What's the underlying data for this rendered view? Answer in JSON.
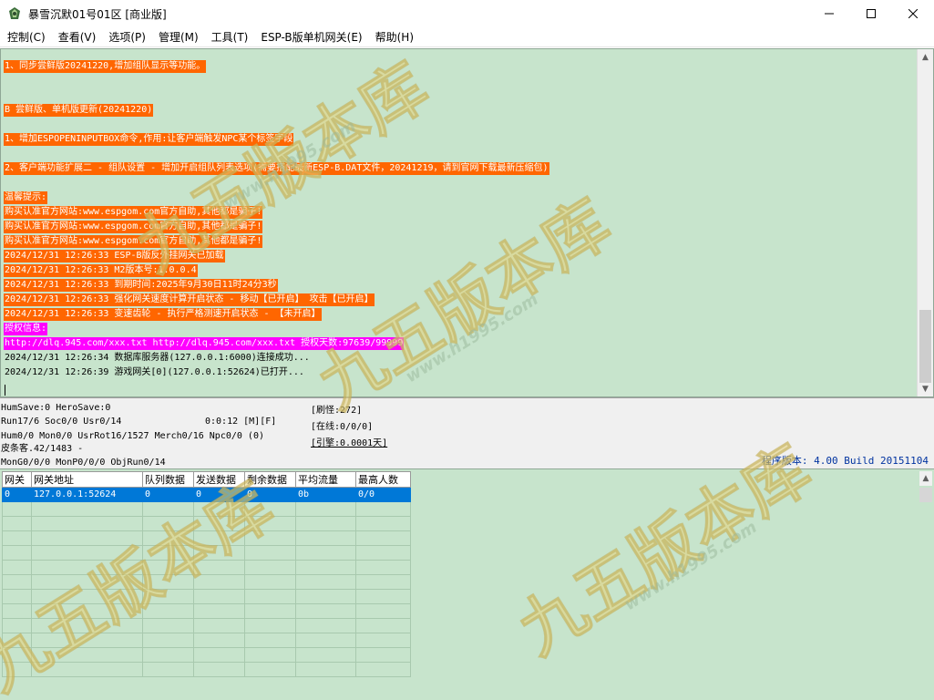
{
  "window": {
    "title": "暴雪沉默01号01区 [商业版]",
    "controls": {
      "minimize": "─",
      "maximize": "☐",
      "close": "✕"
    }
  },
  "menu": [
    "控制(C)",
    "查看(V)",
    "选项(P)",
    "管理(M)",
    "工具(T)",
    "ESP-B版单机网关(E)",
    "帮助(H)"
  ],
  "log": [
    {
      "text": "1、同步尝鲜版20241220,增加组队显示等功能。",
      "hl": "orange"
    },
    {
      "text": "B 尝鲜版、单机版更新(20241220)",
      "hl": "orange"
    },
    {
      "text": "1、增加ESPOPENINPUTBOX命令,作用:让客户端触发NPC某个标签字段",
      "hl": "orange"
    },
    {
      "text": "2、客户端功能扩展二 - 组队设置 - 增加开启组队列表选项(需要搭配最新ESP-B.DAT文件，20241219，请到官网下载最新压缩包)",
      "hl": "orange"
    },
    {
      "text": "温馨提示:",
      "hl": "orange"
    },
    {
      "text": "购买认准官方网站:www.espgom.com官方自助,其他都是骗子!",
      "hl": "orange"
    },
    {
      "text": "购买认准官方网站:www.espgom.com官方自助,其他都是骗子!",
      "hl": "orange"
    },
    {
      "text": "购买认准官方网站:www.espgom.com官方自助,其他都是骗子!",
      "hl": "orange"
    },
    {
      "text": "2024/12/31 12:26:33 ESP-B版反外挂网关已加载",
      "hl": "orange"
    },
    {
      "text": "2024/12/31 12:26:33 M2版本号:1.0.0.4",
      "hl": "orange"
    },
    {
      "text": "2024/12/31 12:26:33 到期时间:2025年9月30日11时24分3秒",
      "hl": "orange"
    },
    {
      "text": "2024/12/31 12:26:33 强化网关速度计算开启状态 - 移动【已开启】 攻击【已开启】",
      "hl": "orange"
    },
    {
      "text": "2024/12/31 12:26:33 变速齿轮 - 执行严格测速开启状态 - 【未开启】",
      "hl": "orange"
    },
    {
      "text": "授权信息:",
      "hl": "magenta"
    },
    {
      "text": "http://dlq.945.com/xxx.txt http://dlq.945.com/xxx.txt 授权天数:97639/99999",
      "hl": "magenta"
    },
    {
      "text": "2024/12/31 12:26:34 数据库服务器(127.0.0.1:6000)连接成功...",
      "hl": "none"
    },
    {
      "text": "2024/12/31 12:26:39 游戏网关[0](127.0.0.1:52624)已打开...",
      "hl": "none"
    }
  ],
  "status": {
    "line1": "HumSave:0 HeroSave:0",
    "line2": "Run17/6 Soc0/0 Usr0/14",
    "timer": "0:0:12 [M][F]",
    "line3": "Hum0/0 Mon0/0 UsrRot16/1527 Merch0/16 Npc0/0 (0)",
    "line4": "皮条客.42/1483 -",
    "line5": "MonG0/0/0 MonP0/0/0 ObjRun0/14",
    "refresh": "[刷怪:272]",
    "online": "[在线:0/0/0]",
    "engine": "[引擎:0.0001天]",
    "version": "程序版本: 4.00 Build 20151104"
  },
  "gateway": {
    "columns": [
      "网关",
      "网关地址",
      "队列数据",
      "发送数据",
      "剩余数据",
      "平均流量",
      "最高人数"
    ],
    "rows": [
      [
        "0",
        "127.0.0.1:52624",
        "0",
        "0",
        "0",
        "0b",
        "0/0"
      ]
    ]
  },
  "watermark": {
    "text": "九五版本库",
    "url": "www.h1995.com"
  },
  "colors": {
    "log_bg": "#c7e4cc",
    "orange": "#ff6600",
    "magenta": "#ff00ff",
    "selected": "#0078d7",
    "version": "#0033a0"
  }
}
